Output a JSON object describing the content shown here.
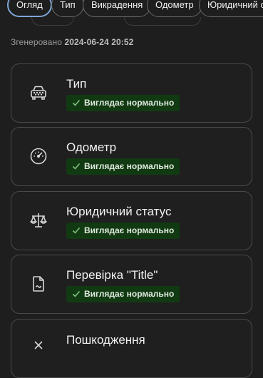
{
  "tabs": [
    {
      "label": "Огляд",
      "active": true
    },
    {
      "label": "Тип",
      "active": false
    },
    {
      "label": "Викрадення",
      "active": false
    },
    {
      "label": "Одометр",
      "active": false
    },
    {
      "label": "Юридичний статус",
      "active": false
    }
  ],
  "generated": {
    "label": "Згенеровано",
    "timestamp": "2024-06-24 20:52"
  },
  "cards": [
    {
      "title": "Тип",
      "status": "Виглядає нормально",
      "icon": "taxi-icon"
    },
    {
      "title": "Одометр",
      "status": "Виглядає нормально",
      "icon": "speedometer-icon"
    },
    {
      "title": "Юридичний статус",
      "status": "Виглядає нормально",
      "icon": "scales-icon"
    },
    {
      "title": "Перевірка \"Title\"",
      "status": "Виглядає нормально",
      "icon": "document-icon"
    },
    {
      "title": "Пошкодження",
      "status": "",
      "icon": "damage-icon"
    }
  ],
  "colors": {
    "background": "#1e1e1e",
    "badge": "#123a12",
    "check": "#7ec07e",
    "active_tab": "#7ea6d8"
  }
}
